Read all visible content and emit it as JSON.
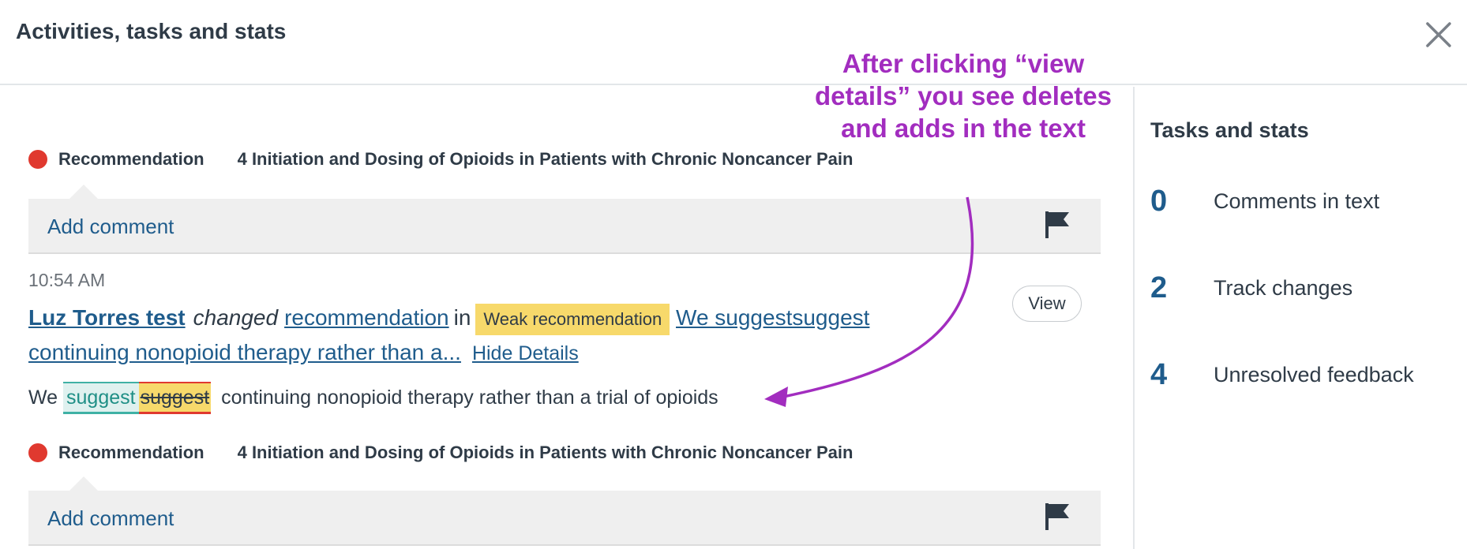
{
  "header": {
    "title": "Activities, tasks and stats",
    "close_icon": "close-icon"
  },
  "annotation": {
    "lines": [
      "After clicking “view",
      "details” you see deletes",
      "and adds in the text"
    ],
    "color": "#a22dbf"
  },
  "groups": [
    {
      "type": "Recommendation",
      "section": "4 Initiation and Dosing of Opioids in Patients with Chronic Noncancer Pain",
      "add_comment": "Add comment"
    },
    {
      "type": "Recommendation",
      "section": "4 Initiation and Dosing of Opioids in Patients with Chronic Noncancer Pain",
      "add_comment": "Add comment"
    }
  ],
  "activity": {
    "time": "10:54 AM",
    "author": "Luz Torres test",
    "action": "changed",
    "object": "recommendation",
    "preposition": "in",
    "badge": "Weak recommendation",
    "target_line1": "We suggestsuggest",
    "target_line2": "continuing nonopioid therapy rather than a...",
    "hide_details": "Hide Details",
    "view_button": "View",
    "diff": {
      "prefix": "We",
      "inserted": "suggest",
      "deleted": "suggest",
      "suffix": "continuing nonopioid therapy rather than a trial of opioids"
    }
  },
  "sidebar": {
    "title": "Tasks and stats",
    "stats": [
      {
        "value": "0",
        "label": "Comments in text"
      },
      {
        "value": "2",
        "label": "Track changes"
      },
      {
        "value": "4",
        "label": "Unresolved feedback"
      }
    ]
  },
  "colors": {
    "link": "#1f5c8c",
    "badge": "#f7d96b",
    "dot": "#e0392f",
    "insert": "#3fb1a5",
    "delete": "#e0392f"
  }
}
